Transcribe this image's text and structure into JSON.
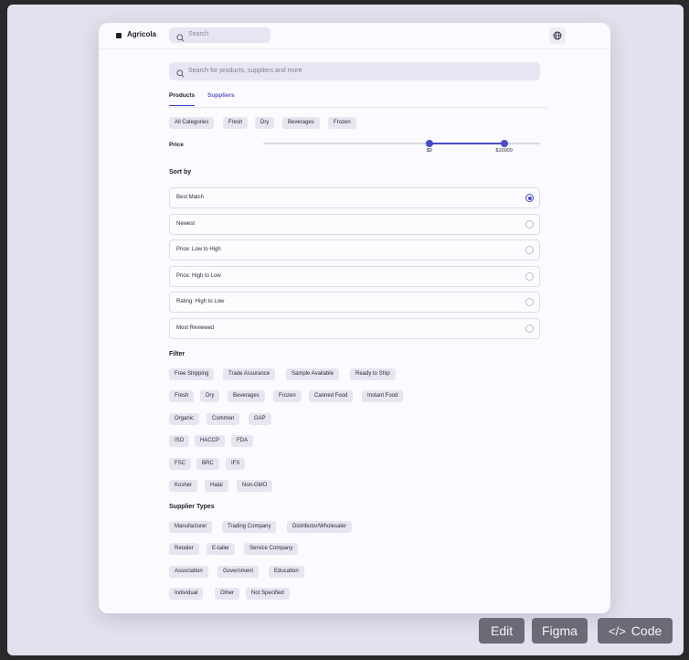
{
  "app": {
    "name": "Agricola"
  },
  "topbar": {
    "search_placeholder": "Search",
    "globe_icon": "globe-icon"
  },
  "main_search": {
    "placeholder": "Search for products, suppliers and more"
  },
  "tabs": [
    {
      "label": "Products",
      "active": true
    },
    {
      "label": "Suppliers",
      "active": false
    }
  ],
  "categories": [
    "All Categories",
    "Fresh",
    "Dry",
    "Beverages",
    "Frozen"
  ],
  "price": {
    "label": "Price",
    "min_label": "$0",
    "max_label": "$10000",
    "range_start_fraction": 0.6,
    "range_end_fraction": 0.87
  },
  "sort": {
    "title": "Sort by",
    "options": [
      {
        "label": "Best Match",
        "selected": true
      },
      {
        "label": "Newest",
        "selected": false
      },
      {
        "label": "Price: Low to High",
        "selected": false
      },
      {
        "label": "Price: High to Low",
        "selected": false
      },
      {
        "label": "Rating: High to Low",
        "selected": false
      },
      {
        "label": "Most Reviewed",
        "selected": false
      }
    ]
  },
  "filter": {
    "title": "Filter",
    "rows": [
      [
        "Free Shipping",
        "Trade Assurance",
        "Sample Available",
        "Ready to Ship"
      ],
      [
        "Fresh",
        "Dry",
        "Beverages",
        "Frozen",
        "Canned Food",
        "Instant Food"
      ],
      [
        "Organic",
        "Common",
        "GAP"
      ],
      [
        "ISO",
        "HACCP",
        "FDA"
      ],
      [
        "FSC",
        "BRC",
        "IFS"
      ],
      [
        "Kosher",
        "Halal",
        "Non-GMO"
      ]
    ]
  },
  "supplier_types": {
    "title": "Supplier Types",
    "rows": [
      [
        "Manufacturer",
        "Trading Company",
        "Distributor/Wholesaler"
      ],
      [
        "Retailer",
        "E-tailer",
        "Service Company"
      ],
      [
        "Association",
        "Government",
        "Education"
      ],
      [
        "Individual",
        "Other",
        "Not Specified"
      ]
    ]
  },
  "footer_buttons": [
    {
      "label": "Edit"
    },
    {
      "label": "Figma"
    },
    {
      "label": "Code"
    }
  ],
  "colors": {
    "accent": "#4a4ac8",
    "background": "#e2e2ee",
    "card": "#fafaff",
    "chip": "#e6e6f0"
  }
}
